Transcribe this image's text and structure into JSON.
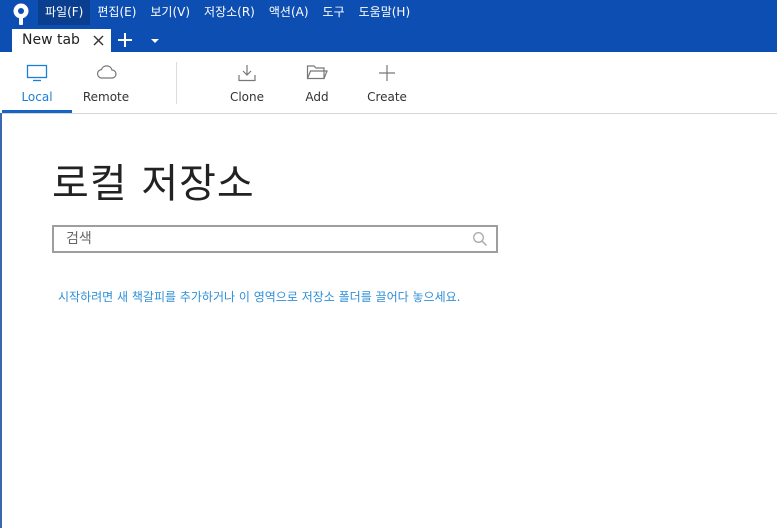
{
  "menu": {
    "items": [
      "파일(F)",
      "편집(E)",
      "보기(V)",
      "저장소(R)",
      "액션(A)",
      "도구",
      "도움말(H)"
    ]
  },
  "tabs": [
    {
      "label": "New tab"
    }
  ],
  "toolbar": {
    "local_label": "Local",
    "remote_label": "Remote",
    "clone_label": "Clone",
    "add_label": "Add",
    "create_label": "Create"
  },
  "main": {
    "title": "로컬 저장소",
    "search_placeholder": "검색",
    "hint": "시작하려면 새 책갈피를 추가하거나 이 영역으로 저장소 폴더를 끌어다 놓으세요."
  },
  "colors": {
    "menubar": "#0c4eb2",
    "accent": "#1764c8",
    "hint_text": "#2e8fd8"
  },
  "icons": [
    "sourcetree-logo-icon",
    "close-icon",
    "plus-icon",
    "chevron-down-icon",
    "monitor-icon",
    "cloud-icon",
    "download-icon",
    "folder-icon",
    "search-icon"
  ]
}
